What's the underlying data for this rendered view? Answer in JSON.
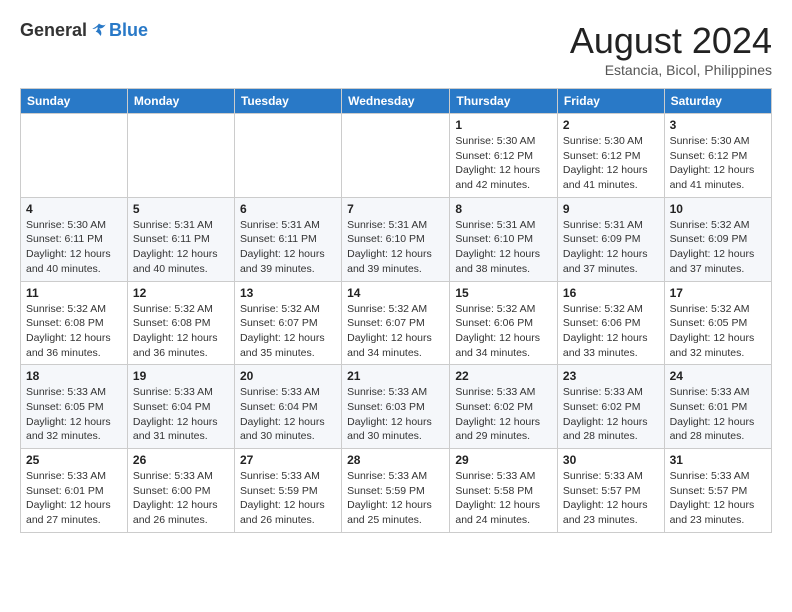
{
  "logo": {
    "general": "General",
    "blue": "Blue"
  },
  "title": "August 2024",
  "subtitle": "Estancia, Bicol, Philippines",
  "days_of_week": [
    "Sunday",
    "Monday",
    "Tuesday",
    "Wednesday",
    "Thursday",
    "Friday",
    "Saturday"
  ],
  "weeks": [
    [
      {
        "day": "",
        "sunrise": "",
        "sunset": "",
        "daylight": ""
      },
      {
        "day": "",
        "sunrise": "",
        "sunset": "",
        "daylight": ""
      },
      {
        "day": "",
        "sunrise": "",
        "sunset": "",
        "daylight": ""
      },
      {
        "day": "",
        "sunrise": "",
        "sunset": "",
        "daylight": ""
      },
      {
        "day": "1",
        "sunrise": "Sunrise: 5:30 AM",
        "sunset": "Sunset: 6:12 PM",
        "daylight": "Daylight: 12 hours and 42 minutes."
      },
      {
        "day": "2",
        "sunrise": "Sunrise: 5:30 AM",
        "sunset": "Sunset: 6:12 PM",
        "daylight": "Daylight: 12 hours and 41 minutes."
      },
      {
        "day": "3",
        "sunrise": "Sunrise: 5:30 AM",
        "sunset": "Sunset: 6:12 PM",
        "daylight": "Daylight: 12 hours and 41 minutes."
      }
    ],
    [
      {
        "day": "4",
        "sunrise": "Sunrise: 5:30 AM",
        "sunset": "Sunset: 6:11 PM",
        "daylight": "Daylight: 12 hours and 40 minutes."
      },
      {
        "day": "5",
        "sunrise": "Sunrise: 5:31 AM",
        "sunset": "Sunset: 6:11 PM",
        "daylight": "Daylight: 12 hours and 40 minutes."
      },
      {
        "day": "6",
        "sunrise": "Sunrise: 5:31 AM",
        "sunset": "Sunset: 6:11 PM",
        "daylight": "Daylight: 12 hours and 39 minutes."
      },
      {
        "day": "7",
        "sunrise": "Sunrise: 5:31 AM",
        "sunset": "Sunset: 6:10 PM",
        "daylight": "Daylight: 12 hours and 39 minutes."
      },
      {
        "day": "8",
        "sunrise": "Sunrise: 5:31 AM",
        "sunset": "Sunset: 6:10 PM",
        "daylight": "Daylight: 12 hours and 38 minutes."
      },
      {
        "day": "9",
        "sunrise": "Sunrise: 5:31 AM",
        "sunset": "Sunset: 6:09 PM",
        "daylight": "Daylight: 12 hours and 37 minutes."
      },
      {
        "day": "10",
        "sunrise": "Sunrise: 5:32 AM",
        "sunset": "Sunset: 6:09 PM",
        "daylight": "Daylight: 12 hours and 37 minutes."
      }
    ],
    [
      {
        "day": "11",
        "sunrise": "Sunrise: 5:32 AM",
        "sunset": "Sunset: 6:08 PM",
        "daylight": "Daylight: 12 hours and 36 minutes."
      },
      {
        "day": "12",
        "sunrise": "Sunrise: 5:32 AM",
        "sunset": "Sunset: 6:08 PM",
        "daylight": "Daylight: 12 hours and 36 minutes."
      },
      {
        "day": "13",
        "sunrise": "Sunrise: 5:32 AM",
        "sunset": "Sunset: 6:07 PM",
        "daylight": "Daylight: 12 hours and 35 minutes."
      },
      {
        "day": "14",
        "sunrise": "Sunrise: 5:32 AM",
        "sunset": "Sunset: 6:07 PM",
        "daylight": "Daylight: 12 hours and 34 minutes."
      },
      {
        "day": "15",
        "sunrise": "Sunrise: 5:32 AM",
        "sunset": "Sunset: 6:06 PM",
        "daylight": "Daylight: 12 hours and 34 minutes."
      },
      {
        "day": "16",
        "sunrise": "Sunrise: 5:32 AM",
        "sunset": "Sunset: 6:06 PM",
        "daylight": "Daylight: 12 hours and 33 minutes."
      },
      {
        "day": "17",
        "sunrise": "Sunrise: 5:32 AM",
        "sunset": "Sunset: 6:05 PM",
        "daylight": "Daylight: 12 hours and 32 minutes."
      }
    ],
    [
      {
        "day": "18",
        "sunrise": "Sunrise: 5:33 AM",
        "sunset": "Sunset: 6:05 PM",
        "daylight": "Daylight: 12 hours and 32 minutes."
      },
      {
        "day": "19",
        "sunrise": "Sunrise: 5:33 AM",
        "sunset": "Sunset: 6:04 PM",
        "daylight": "Daylight: 12 hours and 31 minutes."
      },
      {
        "day": "20",
        "sunrise": "Sunrise: 5:33 AM",
        "sunset": "Sunset: 6:04 PM",
        "daylight": "Daylight: 12 hours and 30 minutes."
      },
      {
        "day": "21",
        "sunrise": "Sunrise: 5:33 AM",
        "sunset": "Sunset: 6:03 PM",
        "daylight": "Daylight: 12 hours and 30 minutes."
      },
      {
        "day": "22",
        "sunrise": "Sunrise: 5:33 AM",
        "sunset": "Sunset: 6:02 PM",
        "daylight": "Daylight: 12 hours and 29 minutes."
      },
      {
        "day": "23",
        "sunrise": "Sunrise: 5:33 AM",
        "sunset": "Sunset: 6:02 PM",
        "daylight": "Daylight: 12 hours and 28 minutes."
      },
      {
        "day": "24",
        "sunrise": "Sunrise: 5:33 AM",
        "sunset": "Sunset: 6:01 PM",
        "daylight": "Daylight: 12 hours and 28 minutes."
      }
    ],
    [
      {
        "day": "25",
        "sunrise": "Sunrise: 5:33 AM",
        "sunset": "Sunset: 6:01 PM",
        "daylight": "Daylight: 12 hours and 27 minutes."
      },
      {
        "day": "26",
        "sunrise": "Sunrise: 5:33 AM",
        "sunset": "Sunset: 6:00 PM",
        "daylight": "Daylight: 12 hours and 26 minutes."
      },
      {
        "day": "27",
        "sunrise": "Sunrise: 5:33 AM",
        "sunset": "Sunset: 5:59 PM",
        "daylight": "Daylight: 12 hours and 26 minutes."
      },
      {
        "day": "28",
        "sunrise": "Sunrise: 5:33 AM",
        "sunset": "Sunset: 5:59 PM",
        "daylight": "Daylight: 12 hours and 25 minutes."
      },
      {
        "day": "29",
        "sunrise": "Sunrise: 5:33 AM",
        "sunset": "Sunset: 5:58 PM",
        "daylight": "Daylight: 12 hours and 24 minutes."
      },
      {
        "day": "30",
        "sunrise": "Sunrise: 5:33 AM",
        "sunset": "Sunset: 5:57 PM",
        "daylight": "Daylight: 12 hours and 23 minutes."
      },
      {
        "day": "31",
        "sunrise": "Sunrise: 5:33 AM",
        "sunset": "Sunset: 5:57 PM",
        "daylight": "Daylight: 12 hours and 23 minutes."
      }
    ]
  ]
}
